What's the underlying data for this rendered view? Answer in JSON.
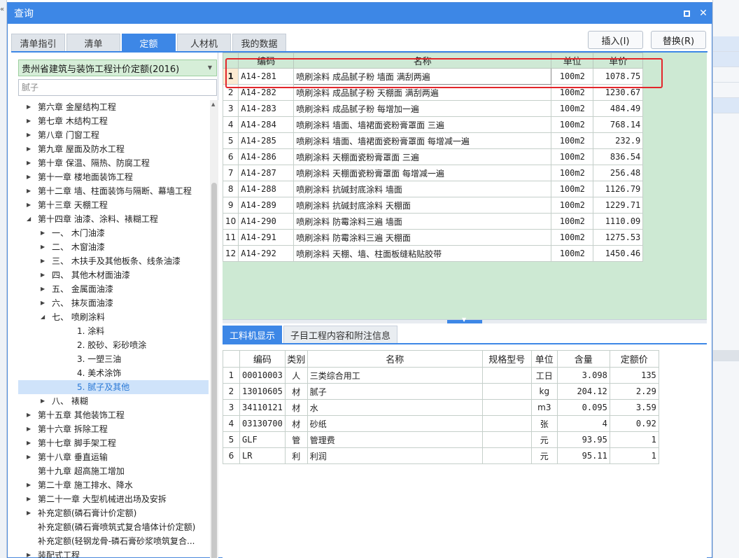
{
  "dialog": {
    "title": "查询",
    "restore_label": "",
    "close_label": "✕"
  },
  "tabs": [
    {
      "label": "清单指引",
      "active": false
    },
    {
      "label": "清单",
      "active": false
    },
    {
      "label": "定额",
      "active": true
    },
    {
      "label": "人材机",
      "active": false
    },
    {
      "label": "我的数据",
      "active": false
    }
  ],
  "actions": {
    "insert_label": "插入(I)",
    "replace_label": "替换(R)"
  },
  "left": {
    "quota_library": "贵州省建筑与装饰工程计价定额(2016)",
    "search_value": "",
    "search_placeholder": "腻子",
    "tree": [
      {
        "label": "第六章 金屋结构工程",
        "level": 0,
        "arrow": "right"
      },
      {
        "label": "第七章 木结构工程",
        "level": 0,
        "arrow": "right"
      },
      {
        "label": "第八章 门窗工程",
        "level": 0,
        "arrow": "right"
      },
      {
        "label": "第九章 屋面及防水工程",
        "level": 0,
        "arrow": "right"
      },
      {
        "label": "第十章 保温、隔热、防腐工程",
        "level": 0,
        "arrow": "right"
      },
      {
        "label": "第十一章 楼地面装饰工程",
        "level": 0,
        "arrow": "right"
      },
      {
        "label": "第十二章 墙、柱面装饰与隔断、幕墙工程",
        "level": 0,
        "arrow": "right"
      },
      {
        "label": "第十三章 天棚工程",
        "level": 0,
        "arrow": "right"
      },
      {
        "label": "第十四章 油漆、涂料、裱糊工程",
        "level": 0,
        "arrow": "down"
      },
      {
        "label": "一、 木门油漆",
        "level": 1,
        "arrow": "right"
      },
      {
        "label": "二、 木窗油漆",
        "level": 1,
        "arrow": "right"
      },
      {
        "label": "三、 木扶手及其他板条、线条油漆",
        "level": 1,
        "arrow": "right"
      },
      {
        "label": "四、 其他木材面油漆",
        "level": 1,
        "arrow": "right"
      },
      {
        "label": "五、 金属面油漆",
        "level": 1,
        "arrow": "right"
      },
      {
        "label": "六、 抹灰面油漆",
        "level": 1,
        "arrow": "right"
      },
      {
        "label": "七、 喷刷涂料",
        "level": 1,
        "arrow": "down"
      },
      {
        "label": "1. 涂料",
        "level": 2,
        "arrow": ""
      },
      {
        "label": "2. 胶砂、彩砂喷涂",
        "level": 2,
        "arrow": ""
      },
      {
        "label": "3. 一塑三油",
        "level": 2,
        "arrow": ""
      },
      {
        "label": "4. 美术涂饰",
        "level": 2,
        "arrow": ""
      },
      {
        "label": "5. 腻子及其他",
        "level": 2,
        "arrow": "",
        "selected": true
      },
      {
        "label": "八、 裱糊",
        "level": 1,
        "arrow": "right"
      },
      {
        "label": "第十五章 其他装饰工程",
        "level": 0,
        "arrow": "right"
      },
      {
        "label": "第十六章 拆除工程",
        "level": 0,
        "arrow": "right"
      },
      {
        "label": "第十七章 脚手架工程",
        "level": 0,
        "arrow": "right"
      },
      {
        "label": "第十八章 垂直运输",
        "level": 0,
        "arrow": "right"
      },
      {
        "label": "第十九章 超高施工增加",
        "level": 0,
        "arrow": ""
      },
      {
        "label": "第二十章 施工排水、降水",
        "level": 0,
        "arrow": "right"
      },
      {
        "label": "第二十一章 大型机械进出场及安拆",
        "level": 0,
        "arrow": "right"
      },
      {
        "label": "补充定额(磷石膏计价定额)",
        "level": 0,
        "arrow": "right"
      },
      {
        "label": "补充定额(磷石膏喷筑式复合墙体计价定额)",
        "level": 0,
        "arrow": ""
      },
      {
        "label": "补充定额(轻钢龙骨-磷石膏砂浆喷筑复合...",
        "level": 0,
        "arrow": ""
      },
      {
        "label": "装配式工程",
        "level": 0,
        "arrow": "right"
      }
    ]
  },
  "quota_table": {
    "columns": [
      "编码",
      "名称",
      "单位",
      "单价"
    ],
    "rows": [
      {
        "no": "1",
        "code": "A14-281",
        "name": "喷刷涂料 成品腻子粉 墙面 满刮两遍",
        "unit": "100m2",
        "price": "1078.75"
      },
      {
        "no": "2",
        "code": "A14-282",
        "name": "喷刷涂料 成品腻子粉 天棚面 满刮两遍",
        "unit": "100m2",
        "price": "1230.67"
      },
      {
        "no": "3",
        "code": "A14-283",
        "name": "喷刷涂料 成品腻子粉 每增加一遍",
        "unit": "100m2",
        "price": "484.49"
      },
      {
        "no": "4",
        "code": "A14-284",
        "name": "喷刷涂料 墙面、墙裙面瓷粉膏罩面 三遍",
        "unit": "100m2",
        "price": "768.14"
      },
      {
        "no": "5",
        "code": "A14-285",
        "name": "喷刷涂料 墙面、墙裙面瓷粉膏罩面 每增减一遍",
        "unit": "100m2",
        "price": "232.9"
      },
      {
        "no": "6",
        "code": "A14-286",
        "name": "喷刷涂料 天棚面瓷粉膏罩面 三遍",
        "unit": "100m2",
        "price": "836.54"
      },
      {
        "no": "7",
        "code": "A14-287",
        "name": "喷刷涂料 天棚面瓷粉膏罩面 每增减一遍",
        "unit": "100m2",
        "price": "256.48"
      },
      {
        "no": "8",
        "code": "A14-288",
        "name": "喷刷涂料 抗碱封底涂料 墙面",
        "unit": "100m2",
        "price": "1126.79"
      },
      {
        "no": "9",
        "code": "A14-289",
        "name": "喷刷涂料 抗碱封底涂料 天棚面",
        "unit": "100m2",
        "price": "1229.71"
      },
      {
        "no": "10",
        "code": "A14-290",
        "name": "喷刷涂料 防霉涂料三遍 墙面",
        "unit": "100m2",
        "price": "1110.09"
      },
      {
        "no": "11",
        "code": "A14-291",
        "name": "喷刷涂料 防霉涂料三遍 天棚面",
        "unit": "100m2",
        "price": "1275.53"
      },
      {
        "no": "12",
        "code": "A14-292",
        "name": "喷刷涂料 天棚、墙、柱面板缝粘贴胶带",
        "unit": "100m2",
        "price": "1450.46"
      }
    ]
  },
  "bottom_tabs": [
    {
      "label": "工料机显示",
      "active": true
    },
    {
      "label": "子目工程内容和附注信息",
      "active": false
    }
  ],
  "detail_table": {
    "columns": [
      "编码",
      "类别",
      "名称",
      "规格型号",
      "单位",
      "含量",
      "定额价"
    ],
    "rows": [
      {
        "no": "1",
        "code": "00010003",
        "type": "人",
        "name": "三类综合用工",
        "spec": "",
        "unit": "工日",
        "qty": "3.098",
        "price": "135"
      },
      {
        "no": "2",
        "code": "13010605",
        "type": "材",
        "name": "腻子",
        "spec": "",
        "unit": "kg",
        "qty": "204.12",
        "price": "2.29"
      },
      {
        "no": "3",
        "code": "34110121",
        "type": "材",
        "name": "水",
        "spec": "",
        "unit": "m3",
        "qty": "0.095",
        "price": "3.59"
      },
      {
        "no": "4",
        "code": "03130700",
        "type": "材",
        "name": "砂纸",
        "spec": "",
        "unit": "张",
        "qty": "4",
        "price": "0.92"
      },
      {
        "no": "5",
        "code": "GLF",
        "type": "管",
        "name": "管理费",
        "spec": "",
        "unit": "元",
        "qty": "93.95",
        "price": "1"
      },
      {
        "no": "6",
        "code": "LR",
        "type": "利",
        "name": "利润",
        "spec": "",
        "unit": "元",
        "qty": "95.11",
        "price": "1"
      }
    ]
  },
  "colors": {
    "accent": "#3d87e6",
    "grid_header_bg": "#cfe9d5",
    "empty_grid_bg": "#cde9d3",
    "highlight": "#e3262b",
    "selected_tree_text": "#2b79d6"
  }
}
